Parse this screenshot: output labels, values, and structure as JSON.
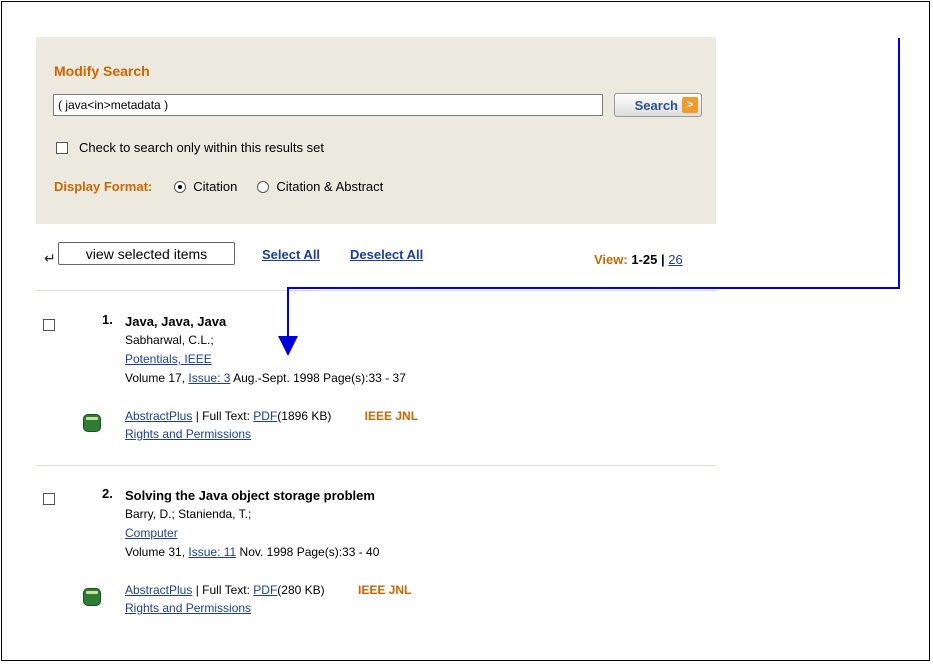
{
  "search": {
    "title": "Modify Search",
    "query": "( java<in>metadata )",
    "button_label": "Search",
    "button_arrow": ">",
    "within_label": "Check to search only within this results set",
    "format_label": "Display Format:",
    "format_options": [
      {
        "label": "Citation",
        "selected": true
      },
      {
        "label": "Citation & Abstract",
        "selected": false
      }
    ]
  },
  "toolbar": {
    "view_selected_label": "view selected items",
    "select_all_label": "Select All",
    "deselect_all_label": "Deselect All",
    "view_label": "View:",
    "view_range": "1-25",
    "view_sep": "|",
    "view_next": "26"
  },
  "results": [
    {
      "num": "1.",
      "title": "Java, Java, Java",
      "authors": "Sabharwal, C.L.;",
      "publication": "Potentials, IEEE",
      "volume": "Volume 17,",
      "issue": "Issue: 3",
      "date_pages": "Aug.-Sept. 1998 Page(s):33 - 37",
      "abstract_link": "AbstractPlus",
      "full_text_label": "| Full Text:",
      "pdf_link": "PDF",
      "pdf_size": "(1896 KB)",
      "type": "IEEE JNL",
      "rights": "Rights and Permissions"
    },
    {
      "num": "2.",
      "title": "Solving the Java object storage problem",
      "authors": "Barry, D.; Stanienda, T.;",
      "publication": "Computer",
      "volume": "Volume 31,",
      "issue": "Issue: 11",
      "date_pages": "Nov. 1998 Page(s):33 - 40",
      "abstract_link": "AbstractPlus",
      "full_text_label": "| Full Text:",
      "pdf_link": "PDF",
      "pdf_size": "(280 KB)",
      "type": "IEEE JNL",
      "rights": "Rights and Permissions"
    }
  ],
  "colors": {
    "accent": "#cc6600",
    "link": "#1a3e9a",
    "panel_bg": "#ece9df",
    "annotation": "#0000dd"
  }
}
